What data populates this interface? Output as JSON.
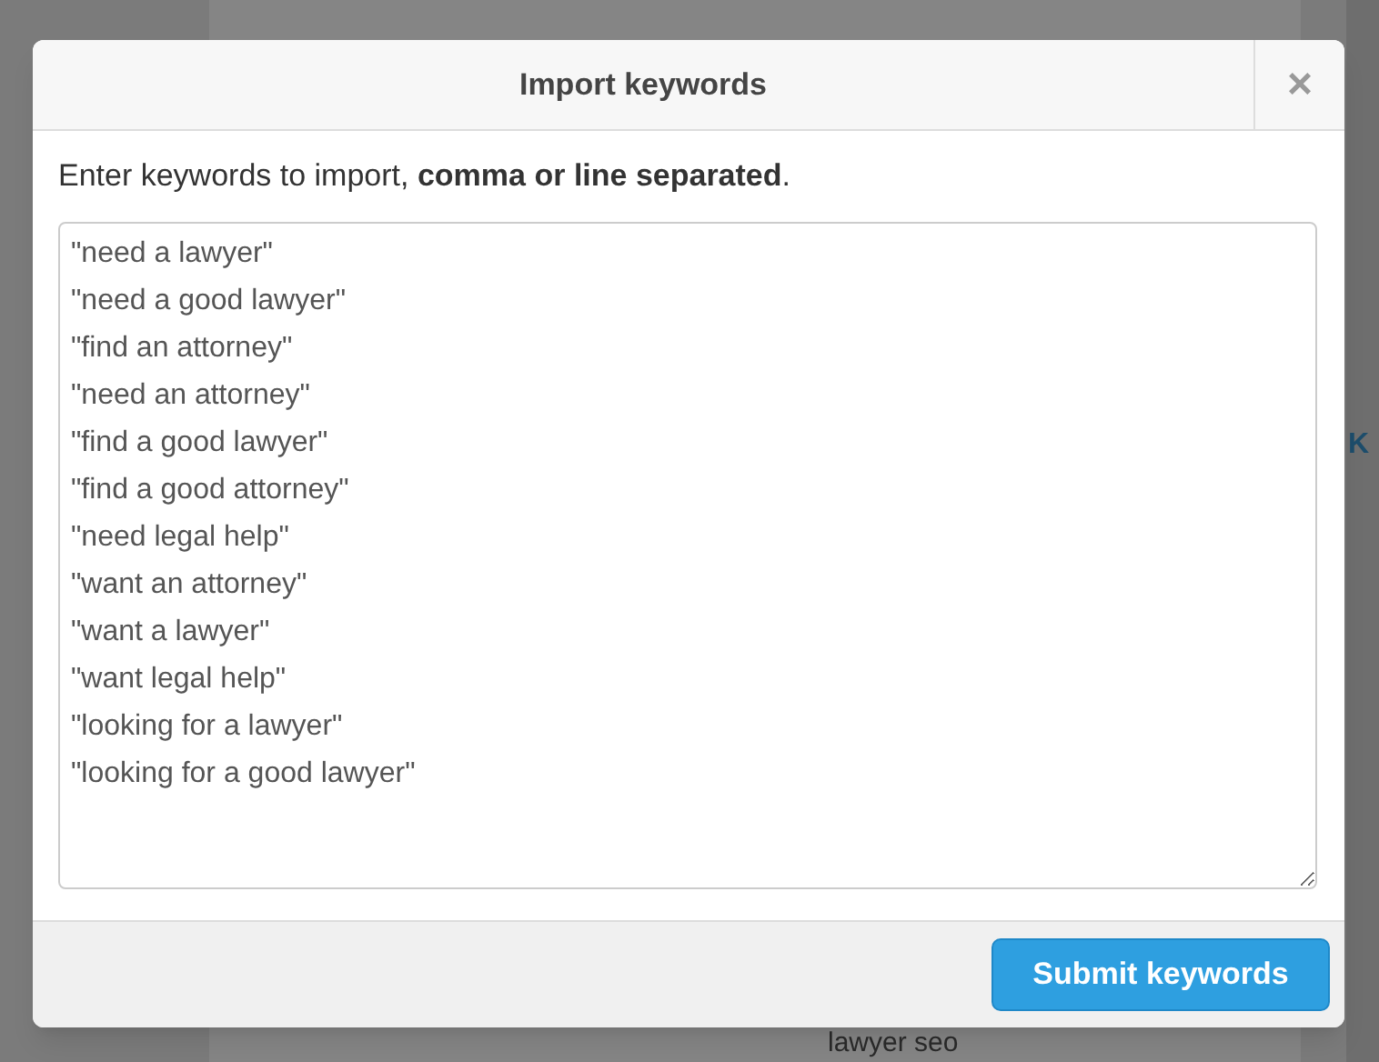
{
  "background": {
    "side_link": "K",
    "dropdown_value": "lawyer seo"
  },
  "dialog": {
    "title": "Import keywords",
    "close": "×",
    "instructions": "Enter keywords to import, **comma or line separated**.",
    "keywords_field": {
      "lines": [
        "\"need a lawyer\"",
        "\"need a good lawyer\"",
        "\"find an attorney\"",
        "\"need an attorney\"",
        "\"find a good lawyer\"",
        "\"find a good attorney\"",
        "\"need legal help\"",
        "\"want an attorney\"",
        "\"want a lawyer\"",
        "\"want legal help\"",
        "\"looking for a lawyer\"",
        "\"looking for a good lawyer\""
      ]
    },
    "submit_button": "Submit keywords"
  }
}
